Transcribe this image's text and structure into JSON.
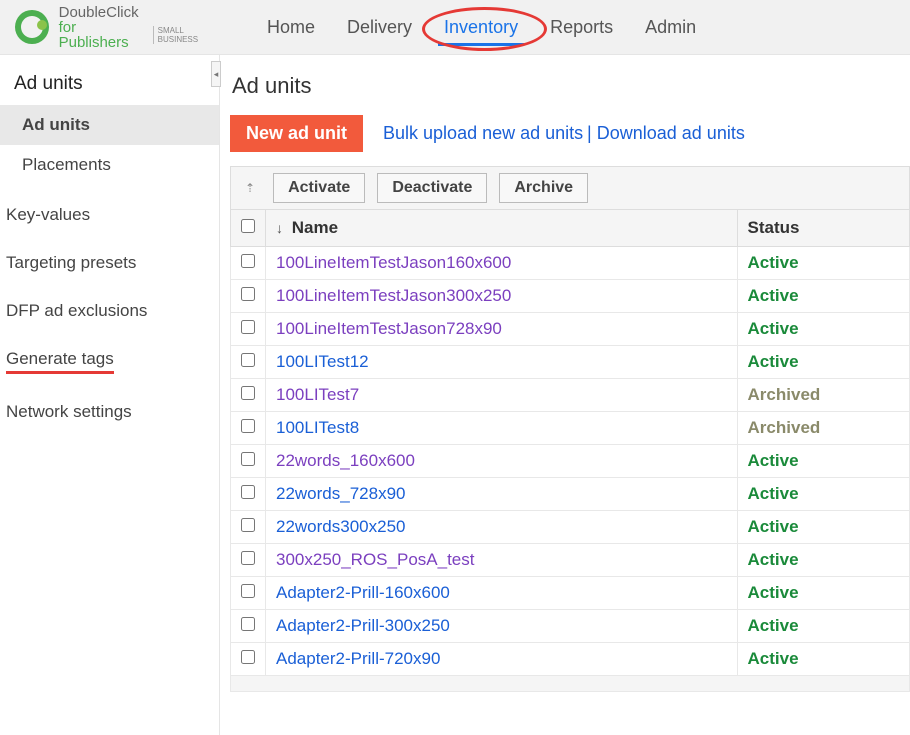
{
  "logo": {
    "line1": "DoubleClick",
    "line2": "for Publishers",
    "sub": "SMALL BUSINESS"
  },
  "nav": {
    "home": "Home",
    "delivery": "Delivery",
    "inventory": "Inventory",
    "reports": "Reports",
    "admin": "Admin"
  },
  "sidebar": {
    "section_title": "Ad units",
    "ad_units": "Ad units",
    "placements": "Placements",
    "key_values": "Key-values",
    "targeting_presets": "Targeting presets",
    "dfp_ad_exclusions": "DFP ad exclusions",
    "generate_tags": "Generate tags",
    "network_settings": "Network settings"
  },
  "content": {
    "page_title": "Ad units",
    "new_ad_unit": "New ad unit",
    "bulk_upload": "Bulk upload new ad units",
    "pipe": " | ",
    "download": "Download ad units",
    "activate": "Activate",
    "deactivate": "Deactivate",
    "archive": "Archive",
    "col_name": "Name",
    "col_status": "Status"
  },
  "rows": [
    {
      "name": "100LineItemTestJason160x600",
      "visited": true,
      "status": "Active"
    },
    {
      "name": "100LineItemTestJason300x250",
      "visited": true,
      "status": "Active"
    },
    {
      "name": "100LineItemTestJason728x90",
      "visited": true,
      "status": "Active"
    },
    {
      "name": "100LITest12",
      "visited": false,
      "status": "Active"
    },
    {
      "name": "100LITest7",
      "visited": true,
      "status": "Archived"
    },
    {
      "name": "100LITest8",
      "visited": false,
      "status": "Archived"
    },
    {
      "name": "22words_160x600",
      "visited": true,
      "status": "Active"
    },
    {
      "name": "22words_728x90",
      "visited": false,
      "status": "Active"
    },
    {
      "name": "22words300x250",
      "visited": false,
      "status": "Active"
    },
    {
      "name": "300x250_ROS_PosA_test",
      "visited": true,
      "status": "Active"
    },
    {
      "name": "Adapter2-Prill-160x600",
      "visited": false,
      "status": "Active"
    },
    {
      "name": "Adapter2-Prill-300x250",
      "visited": false,
      "status": "Active"
    },
    {
      "name": "Adapter2-Prill-720x90",
      "visited": false,
      "status": "Active"
    }
  ]
}
